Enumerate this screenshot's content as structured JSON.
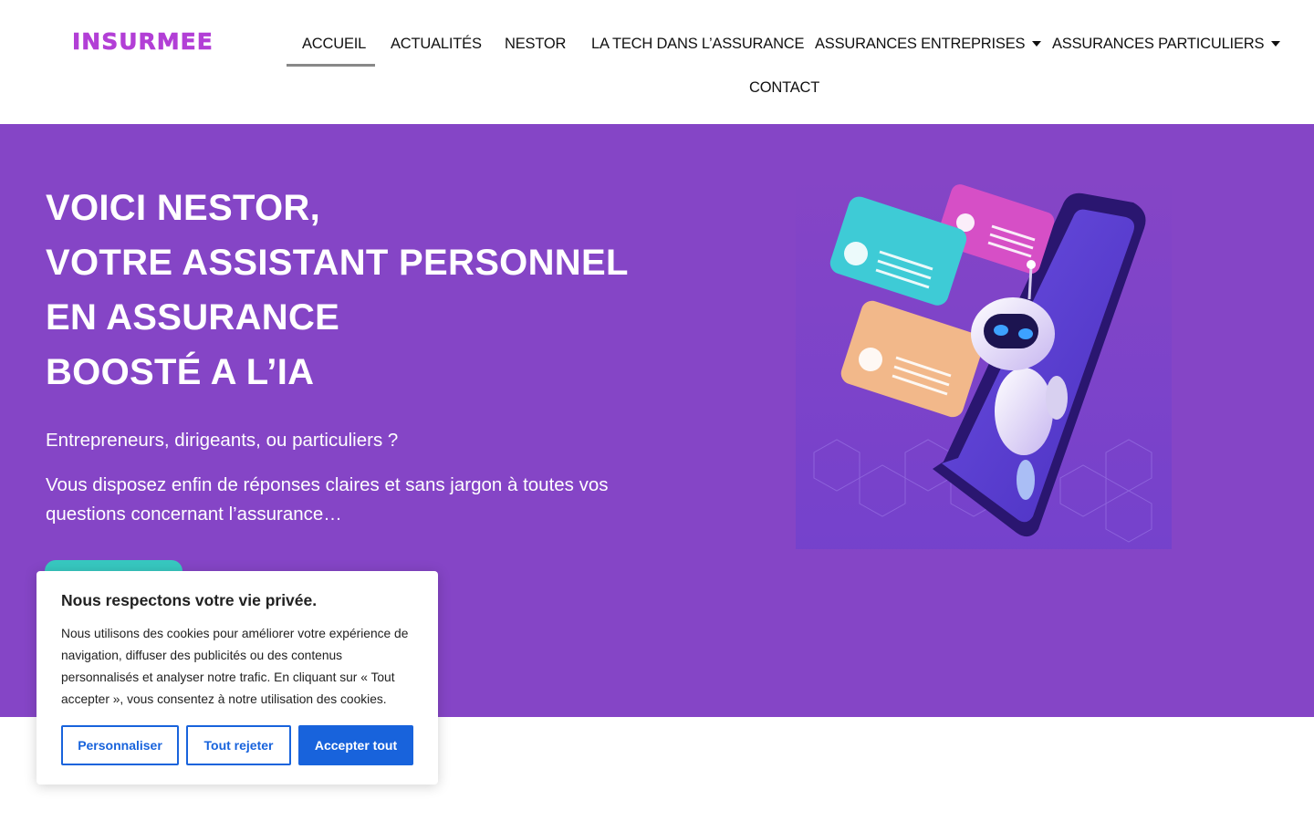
{
  "brand": {
    "logo": "INSURMEE",
    "accent": "#b23fd6"
  },
  "nav": {
    "items": [
      {
        "label": "ACCUEIL",
        "active": true
      },
      {
        "label": "ACTUALITÉS"
      },
      {
        "label": "NESTOR"
      },
      {
        "label": "LA TECH DANS L’ASSURANCE"
      },
      {
        "label": "ASSURANCES ENTREPRISES",
        "dropdown": true
      },
      {
        "label": "ASSURANCES PARTICULIERS",
        "dropdown": true
      },
      {
        "label": "CONTACT"
      }
    ]
  },
  "hero": {
    "background": "#8545c6",
    "title_lines": [
      "VOICI NESTOR,",
      "VOTRE ASSISTANT PERSONNEL",
      "EN ASSURANCE",
      "BOOSTÉ A L’IA"
    ],
    "subtitle": "Entrepreneurs, dirigeants, ou particuliers ?",
    "description": "Vous disposez enfin de réponses claires et sans jargon à toutes vos questions concernant l’assurance…",
    "cta_color": "#37c8c0"
  },
  "cookie_banner": {
    "title": "Nous respectons votre vie privée.",
    "text": "Nous utilisons des cookies pour améliorer votre expérience de navigation, diffuser des publicités ou des contenus personnalisés et analyser notre trafic. En cliquant sur « Tout accepter », vous consentez à notre utilisation des cookies.",
    "buttons": {
      "customize": "Personnaliser",
      "reject": "Tout rejeter",
      "accept": "Accepter tout"
    },
    "button_color": "#1863dc"
  }
}
